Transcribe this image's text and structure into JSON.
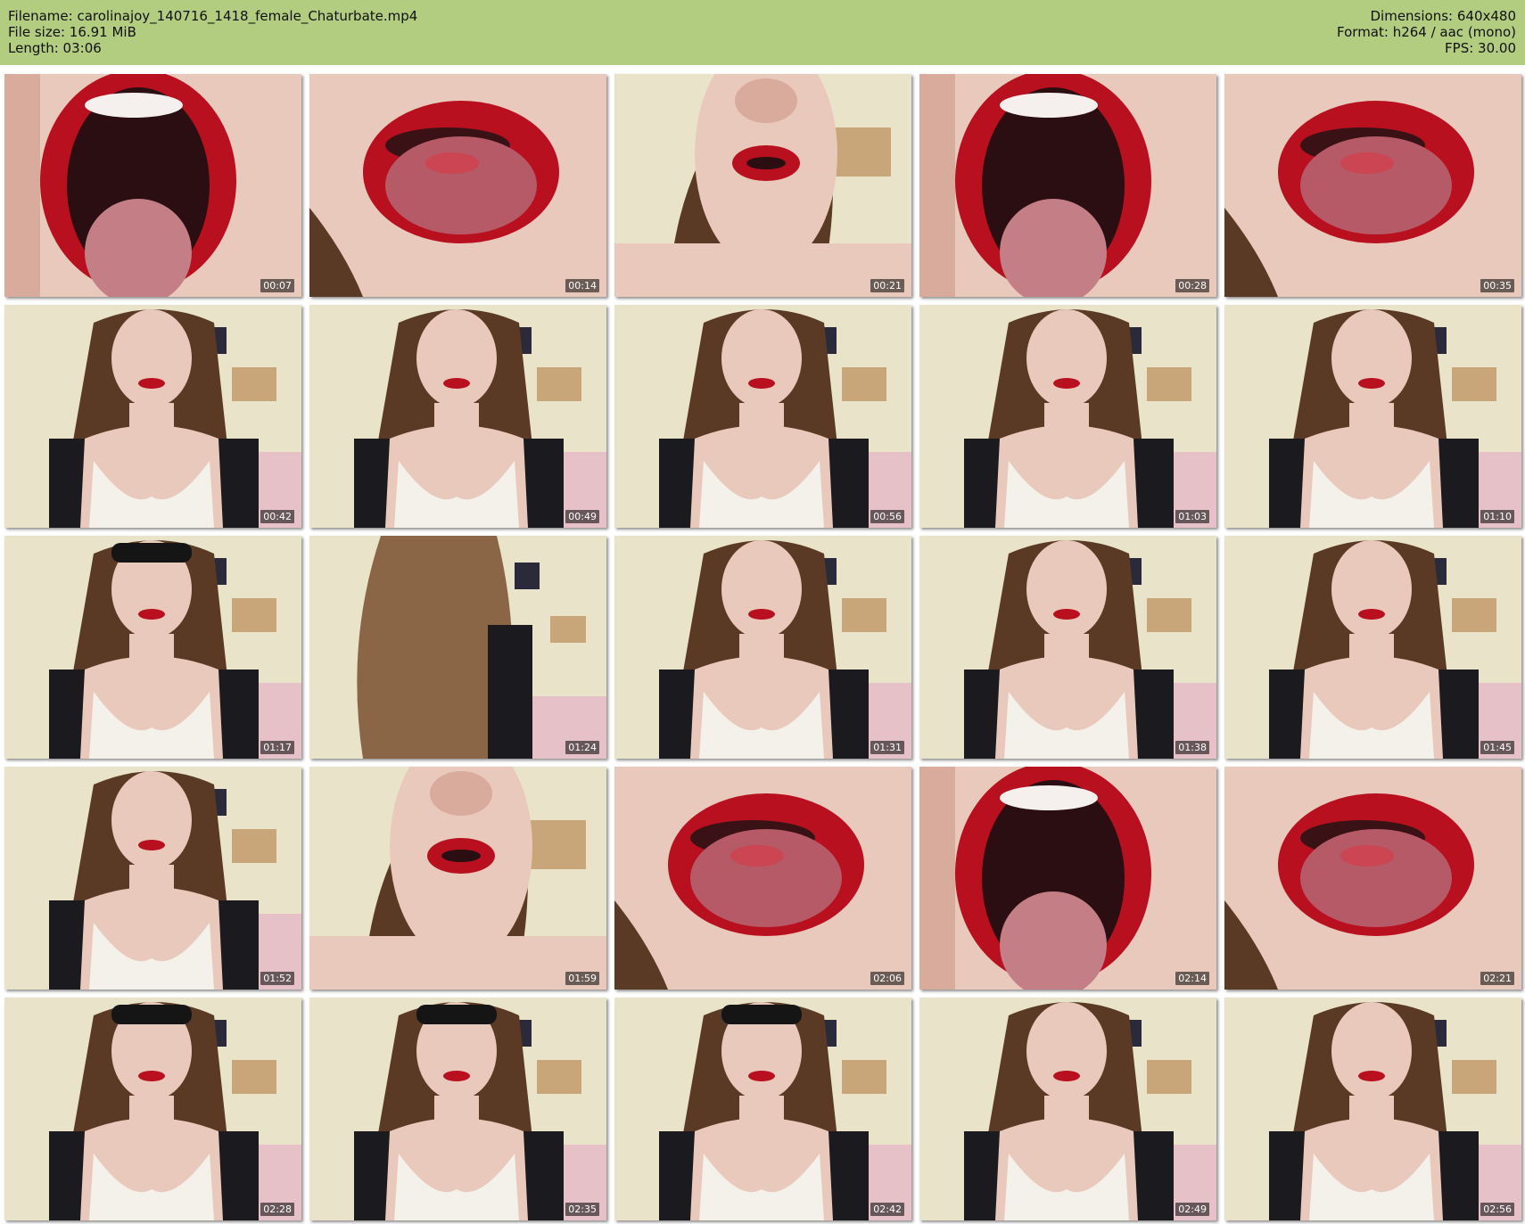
{
  "header": {
    "filename": "Filename: carolinajoy_140716_1418_female_Chaturbate.mp4",
    "filesize": "File size: 16.91 MiB",
    "length": "Length: 03:06",
    "dimensions": "Dimensions: 640x480",
    "format": "Format: h264 / aac (mono)",
    "fps": "FPS: 30.00",
    "background_color": "#b3cd80"
  },
  "thumbnails": [
    {
      "time": "00:07",
      "kind": "mouth-open"
    },
    {
      "time": "00:14",
      "kind": "mouth-tongue"
    },
    {
      "time": "00:21",
      "kind": "face-close"
    },
    {
      "time": "00:28",
      "kind": "mouth-open"
    },
    {
      "time": "00:35",
      "kind": "mouth-tongue"
    },
    {
      "time": "00:42",
      "kind": "room-person"
    },
    {
      "time": "00:49",
      "kind": "room-person"
    },
    {
      "time": "00:56",
      "kind": "room-person"
    },
    {
      "time": "01:03",
      "kind": "room-person"
    },
    {
      "time": "01:10",
      "kind": "room-person"
    },
    {
      "time": "01:17",
      "kind": "room-glasses"
    },
    {
      "time": "01:24",
      "kind": "room-hair"
    },
    {
      "time": "01:31",
      "kind": "room-person"
    },
    {
      "time": "01:38",
      "kind": "room-person"
    },
    {
      "time": "01:45",
      "kind": "room-person"
    },
    {
      "time": "01:52",
      "kind": "room-person"
    },
    {
      "time": "01:59",
      "kind": "face-close"
    },
    {
      "time": "02:06",
      "kind": "mouth-tongue"
    },
    {
      "time": "02:14",
      "kind": "mouth-open"
    },
    {
      "time": "02:21",
      "kind": "mouth-tongue"
    },
    {
      "time": "02:28",
      "kind": "room-glasses"
    },
    {
      "time": "02:35",
      "kind": "room-glasses"
    },
    {
      "time": "02:42",
      "kind": "room-glasses"
    },
    {
      "time": "02:49",
      "kind": "room-person"
    },
    {
      "time": "02:56",
      "kind": "room-person"
    }
  ]
}
